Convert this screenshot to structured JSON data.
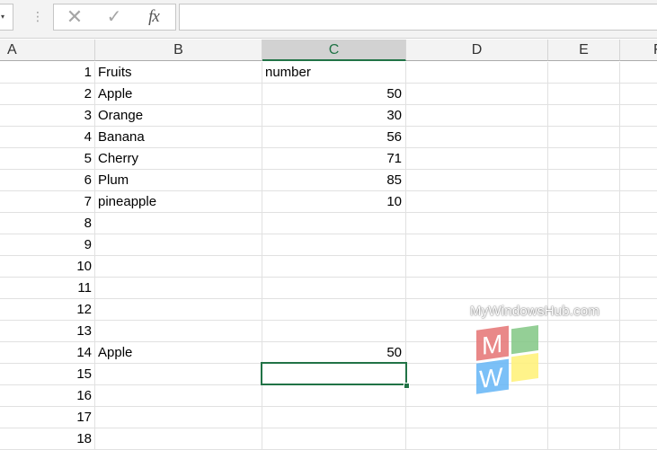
{
  "formula_bar": {
    "name_box_arrow": "▾",
    "separator": "⋮",
    "cancel_symbol": "✕",
    "enter_symbol": "✓",
    "fx_label": "fx",
    "formula_value": ""
  },
  "columns": [
    "A",
    "B",
    "C",
    "D",
    "E",
    "F"
  ],
  "rows": [
    {
      "num": "1",
      "b": "Fruits",
      "c": "number",
      "c_numeric": false
    },
    {
      "num": "2",
      "b": "Apple",
      "c": "50",
      "c_numeric": true
    },
    {
      "num": "3",
      "b": "Orange",
      "c": "30",
      "c_numeric": true
    },
    {
      "num": "4",
      "b": "Banana",
      "c": "56",
      "c_numeric": true
    },
    {
      "num": "5",
      "b": "Cherry",
      "c": "71",
      "c_numeric": true
    },
    {
      "num": "6",
      "b": "Plum",
      "c": "85",
      "c_numeric": true
    },
    {
      "num": "7",
      "b": "pineapple",
      "c": "10",
      "c_numeric": true
    },
    {
      "num": "8",
      "b": "",
      "c": "",
      "c_numeric": false
    },
    {
      "num": "9",
      "b": "",
      "c": "",
      "c_numeric": false
    },
    {
      "num": "10",
      "b": "",
      "c": "",
      "c_numeric": false
    },
    {
      "num": "11",
      "b": "",
      "c": "",
      "c_numeric": false
    },
    {
      "num": "12",
      "b": "",
      "c": "",
      "c_numeric": false
    },
    {
      "num": "13",
      "b": "",
      "c": "",
      "c_numeric": false
    },
    {
      "num": "14",
      "b": "Apple",
      "c": "50",
      "c_numeric": true
    },
    {
      "num": "15",
      "b": "",
      "c": "",
      "c_numeric": false
    },
    {
      "num": "16",
      "b": "",
      "c": "",
      "c_numeric": false
    },
    {
      "num": "17",
      "b": "",
      "c": "",
      "c_numeric": false
    },
    {
      "num": "18",
      "b": "",
      "c": "",
      "c_numeric": false
    }
  ],
  "selection": {
    "active_column": "C",
    "active_row": "15",
    "accent_color": "#217346"
  },
  "watermark": {
    "text": "MyWindowsHub.com",
    "logo_letters": [
      "M",
      "W"
    ],
    "logo_colors": [
      "#e57373",
      "#81c784",
      "#64b5f6",
      "#fff176"
    ]
  }
}
